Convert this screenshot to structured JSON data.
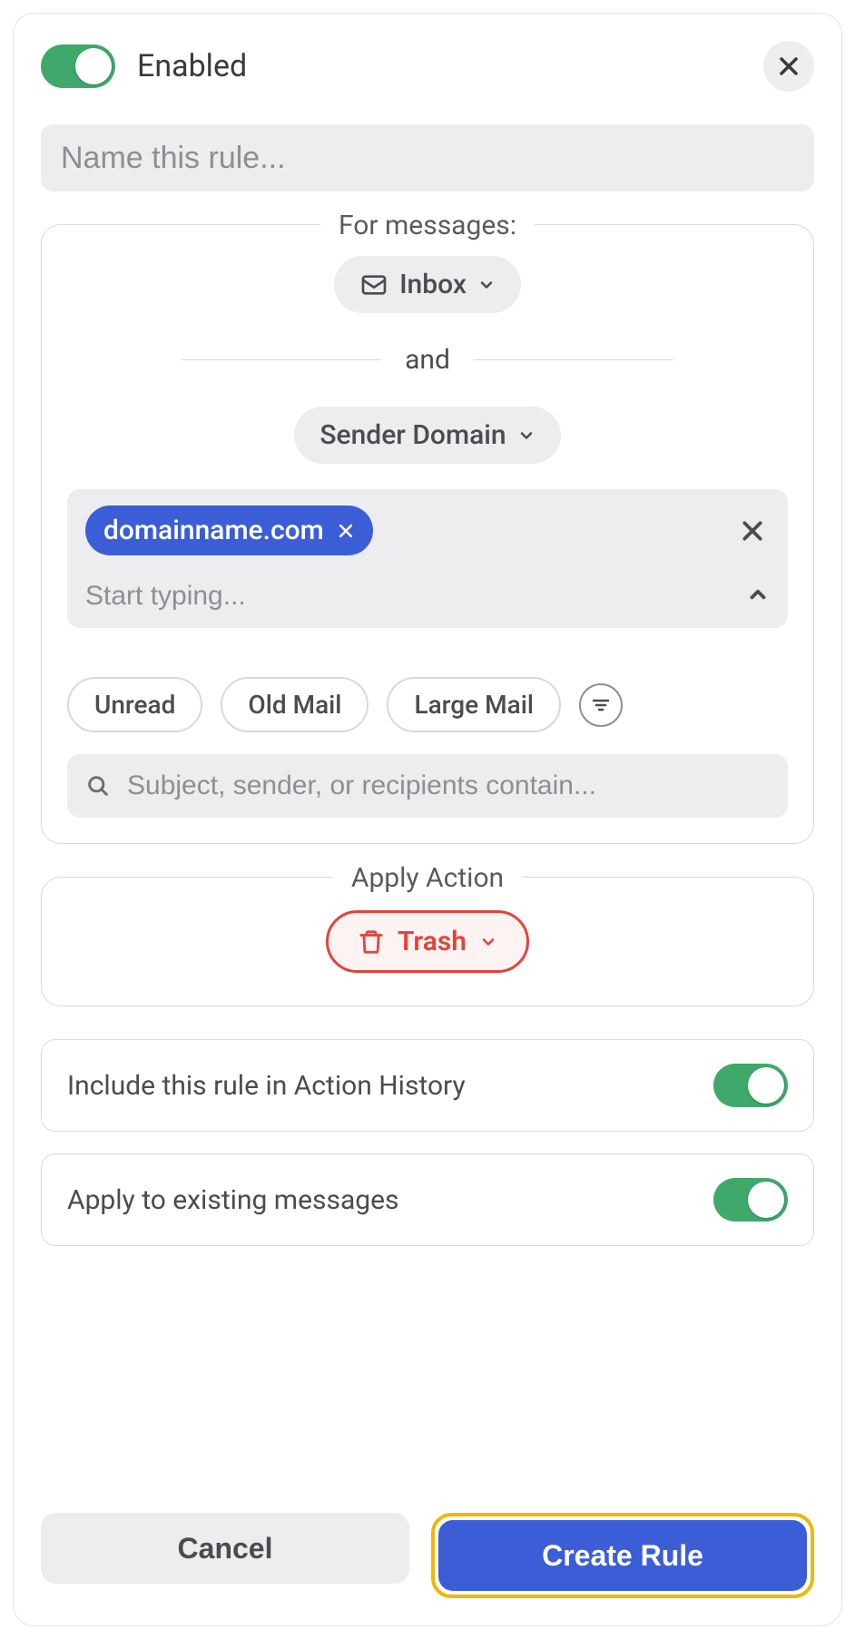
{
  "header": {
    "enabled_label": "Enabled"
  },
  "name_input": {
    "placeholder": "Name this rule..."
  },
  "for_messages": {
    "legend": "For messages:",
    "folder_label": "Inbox",
    "and_label": "and",
    "condition_label": "Sender Domain",
    "domain_chip": "domainname.com",
    "typing_placeholder": "Start typing...",
    "filters": [
      "Unread",
      "Old Mail",
      "Large Mail"
    ],
    "search_placeholder": "Subject, sender, or recipients contain..."
  },
  "apply_action": {
    "legend": "Apply Action",
    "action_label": "Trash"
  },
  "options": {
    "include_history": "Include this rule in Action History",
    "apply_existing": "Apply to existing messages"
  },
  "buttons": {
    "cancel": "Cancel",
    "create": "Create Rule"
  }
}
